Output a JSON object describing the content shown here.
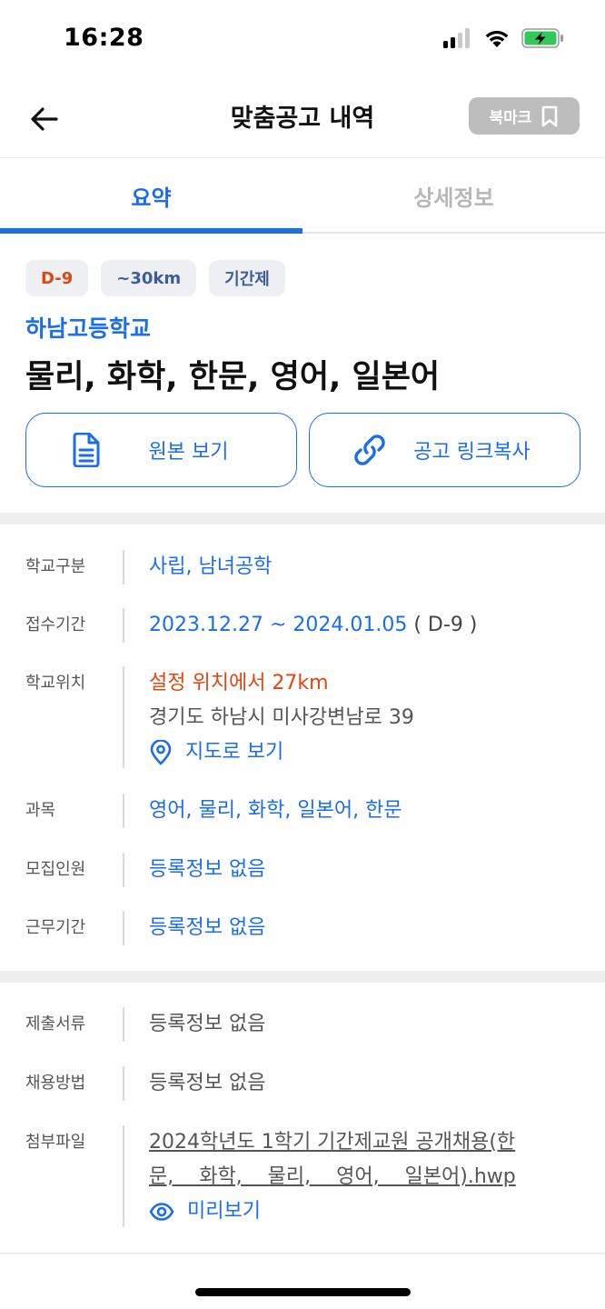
{
  "status": {
    "time": "16:28"
  },
  "header": {
    "title": "맞춤공고 내역",
    "bookmark_label": "북마크"
  },
  "tabs": [
    {
      "label": "요약",
      "active": true
    },
    {
      "label": "상세정보",
      "active": false
    }
  ],
  "summary": {
    "badges": [
      "D-9",
      "~30km",
      "기간제"
    ],
    "school_name": "하남고등학교",
    "job_title": "물리, 화학, 한문, 영어, 일본어",
    "buttons": {
      "original": "원본 보기",
      "copy_link": "공고 링크복사"
    }
  },
  "info": {
    "school_type": {
      "label": "학교구분",
      "value": "사립, 남녀공학"
    },
    "period": {
      "label": "접수기간",
      "value": "2023.12.27 ~ 2024.01.05",
      "dday": "( D-9 )"
    },
    "location": {
      "label": "학교위치",
      "distance": "설정 위치에서 27km",
      "address": "경기도 하남시 미사강변남로 39",
      "map_link": "지도로 보기"
    },
    "subjects": {
      "label": "과목",
      "value": "영어, 물리, 화학, 일본어, 한문"
    },
    "recruits": {
      "label": "모집인원",
      "value": "등록정보 없음"
    },
    "work_period": {
      "label": "근무기간",
      "value": "등록정보 없음"
    }
  },
  "docs": {
    "documents": {
      "label": "제출서류",
      "value": "등록정보 없음"
    },
    "method": {
      "label": "채용방법",
      "value": "등록정보 없음"
    },
    "attachment": {
      "label": "첨부파일",
      "line1": "2024학년도 1학기 기간제교원 공개채용(한",
      "line2": "문,    화학,    물리,    영어,    일본어).hwp",
      "preview": "미리보기"
    }
  },
  "colors": {
    "accent": "#1a6ee8",
    "warning": "#e0460f",
    "bookmark_bg": "#bdbdbd"
  }
}
